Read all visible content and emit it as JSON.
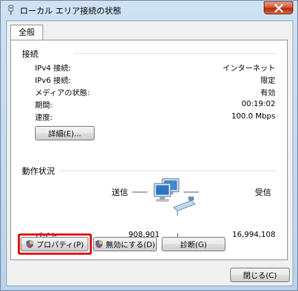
{
  "window": {
    "title": "ローカル エリア接続の状態"
  },
  "tabs": [
    {
      "label": "全般"
    }
  ],
  "connection": {
    "section_title": "接続",
    "rows": [
      {
        "label": "IPv4 接続:",
        "value": "インターネット"
      },
      {
        "label": "IPv6 接続:",
        "value": "限定"
      },
      {
        "label": "メディアの状態:",
        "value": "有効"
      },
      {
        "label": "期間:",
        "value": "00:19:02"
      },
      {
        "label": "速度:",
        "value": "100.0 Mbps"
      }
    ],
    "details_button": "詳細(E)..."
  },
  "activity": {
    "section_title": "動作状況",
    "sent_label": "送信",
    "received_label": "受信",
    "bytes_label": "バイト:",
    "bytes_sent": "908,901",
    "bytes_received": "16,994,108"
  },
  "buttons": {
    "properties": "プロパティ(P)",
    "disable": "無効にする(D)",
    "diagnose": "診断(G)",
    "close": "閉じる(C)"
  },
  "colors": {
    "highlight": "#e00000",
    "close_button": "#c84a2c"
  }
}
